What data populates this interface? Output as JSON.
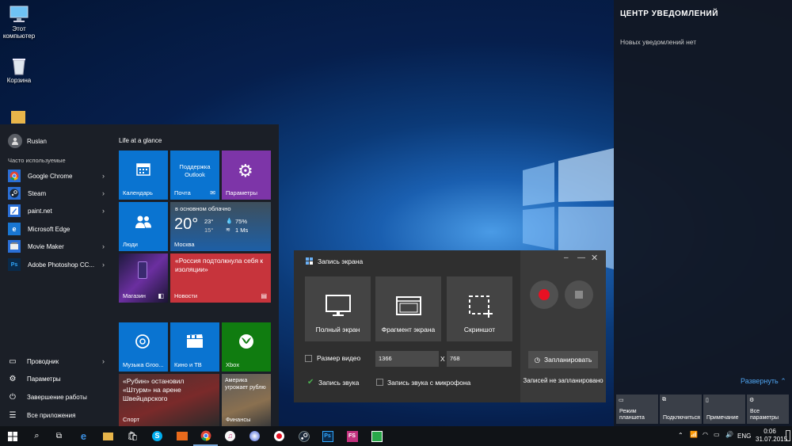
{
  "desktop": {
    "icons": [
      {
        "label": "Этот компьютер"
      },
      {
        "label": "Корзина"
      }
    ]
  },
  "start": {
    "user": "Ruslan",
    "frequent_label": "Часто используемые",
    "apps": [
      {
        "label": "Google Chrome"
      },
      {
        "label": "Steam"
      },
      {
        "label": "paint.net"
      },
      {
        "label": "Microsoft Edge"
      },
      {
        "label": "Movie Maker"
      },
      {
        "label": "Adobe Photoshop CC..."
      }
    ],
    "system": [
      {
        "label": "Проводник"
      },
      {
        "label": "Параметры"
      },
      {
        "label": "Завершение работы"
      },
      {
        "label": "Все приложения"
      }
    ],
    "group_title": "Life at a glance",
    "tiles": {
      "calendar": "Календарь",
      "mail_top": "Поддержка Outlook",
      "mail": "Почта",
      "settings": "Параметры",
      "people": "Люди",
      "weather": {
        "cond": "в основном облачно",
        "temp": "20°",
        "hi": "23°",
        "lo": "15°",
        "humidity": "75%",
        "wind": "1 Ms",
        "city": "Москва"
      },
      "store": "Магазин",
      "news_headline": "«Россия подтолкнула себя к изоляции»",
      "news": "Новости",
      "groove": "Музыка Groo...",
      "movies": "Кино и ТВ",
      "xbox": "Xbox",
      "sport_headline": "«Рубин» остановил «Штурм» на арене Швейцарского",
      "sport": "Спорт",
      "finance_headline": "Америка угрожает рублю",
      "finance": "Финансы"
    }
  },
  "notifications": {
    "title": "ЦЕНТР УВЕДОМЛЕНИЙ",
    "empty": "Новых уведомлений нет",
    "expand": "Развернуть",
    "quick_actions": [
      {
        "label": "Режим планшета"
      },
      {
        "label": "Подключиться"
      },
      {
        "label": "Примечание"
      },
      {
        "label": "Все параметры"
      }
    ]
  },
  "recorder": {
    "title": "Запись экрана",
    "modes": [
      {
        "label": "Полный экран"
      },
      {
        "label": "Фрагмент экрана"
      },
      {
        "label": "Скриншот"
      }
    ],
    "video_size_label": "Размер видео",
    "width": "1366",
    "height": "768",
    "x_label": "X",
    "audio_label": "Запись звука",
    "audio_checked": true,
    "mic_label": "Запись звука с микрофона",
    "mic_checked": false,
    "schedule_button": "Запланировать",
    "schedule_status": "Записей не запланировано",
    "record_color": "#e81123"
  },
  "taskbar": {
    "lang": "ENG",
    "time": "0:06",
    "date": "31.07.2015"
  },
  "colors": {
    "accent": "#0a74d1",
    "news": "#c7343c",
    "xbox": "#107c10",
    "settings": "#7d35a8"
  }
}
